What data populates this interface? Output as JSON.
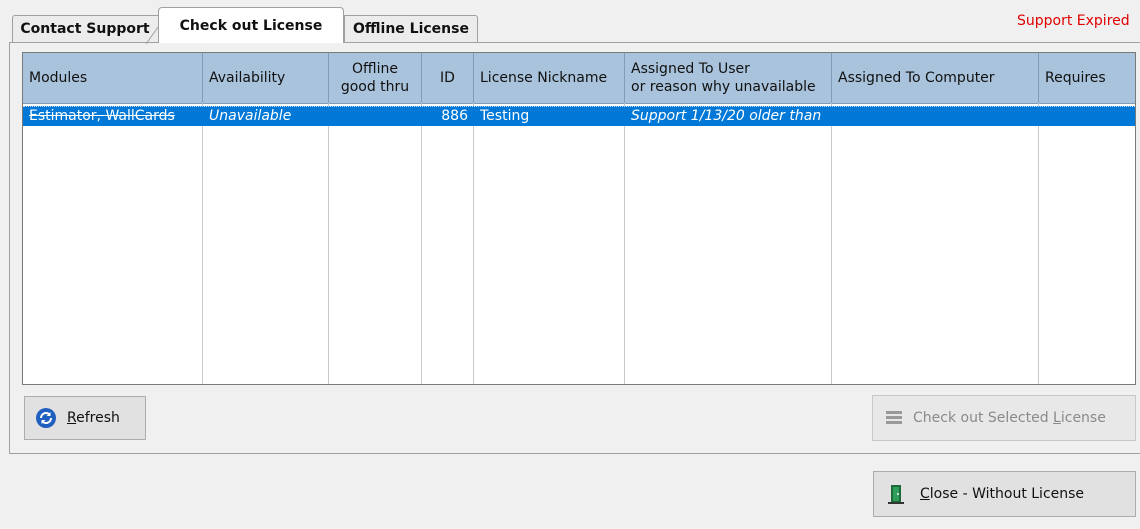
{
  "tabs": [
    {
      "label": "Contact Support"
    },
    {
      "label": "Check out License"
    },
    {
      "label": "Offline License"
    }
  ],
  "status_text": "Support Expired",
  "grid": {
    "columns": [
      "Modules",
      "Availability",
      "Offline\ngood thru",
      "ID",
      "License Nickname",
      "Assigned To User\nor reason why unavailable",
      "Assigned To Computer",
      "Requires"
    ],
    "rows": [
      {
        "modules": "Estimator, WallCards",
        "availability": "Unavailable",
        "offline_good_thru": "",
        "id": "886",
        "nickname": "Testing",
        "assigned_user": "Support 1/13/20  older than",
        "assigned_computer": "",
        "requires": ""
      }
    ]
  },
  "buttons": {
    "refresh": {
      "label": "Refresh",
      "underline": "R",
      "rest": "efresh",
      "icon": "refresh-icon"
    },
    "checkout": {
      "label_pre": "Check out Selected ",
      "underline": "L",
      "label_post": "icense",
      "icon": "license-stack-icon"
    },
    "close": {
      "underline": "C",
      "label_post": "lose - Without License",
      "icon": "exit-door-icon"
    }
  },
  "colors": {
    "selection": "#0078d7",
    "header": "#a9c3dc",
    "status_text": "#e00000"
  }
}
